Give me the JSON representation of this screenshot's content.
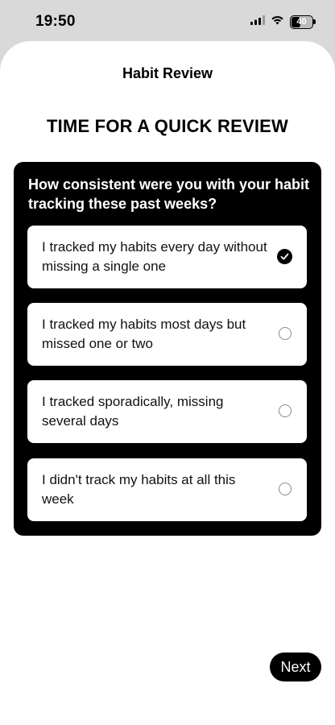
{
  "status_bar": {
    "time": "19:50",
    "battery_level": "40"
  },
  "header": {
    "title": "Habit Review"
  },
  "main": {
    "heading": "TIME FOR A QUICK REVIEW",
    "question": "How consistent were you with your habit tracking these past weeks?",
    "options": [
      {
        "label": "I tracked my habits every day without missing a single one",
        "selected": true
      },
      {
        "label": "I tracked my habits most days but missed one or two",
        "selected": false
      },
      {
        "label": "I tracked sporadically, missing several days",
        "selected": false
      },
      {
        "label": "I didn't track my habits at all this week",
        "selected": false
      }
    ]
  },
  "footer": {
    "next_label": "Next"
  },
  "colors": {
    "card_background": "#000000",
    "option_background": "#ffffff",
    "sheet_background": "#ffffff",
    "status_background": "#d9d9d9",
    "accent": "#000000"
  },
  "icons": {
    "signal": "cellular-signal-icon",
    "wifi": "wifi-icon",
    "battery": "battery-icon",
    "selected": "checkmark-circle-icon",
    "unselected": "empty-circle-icon"
  }
}
